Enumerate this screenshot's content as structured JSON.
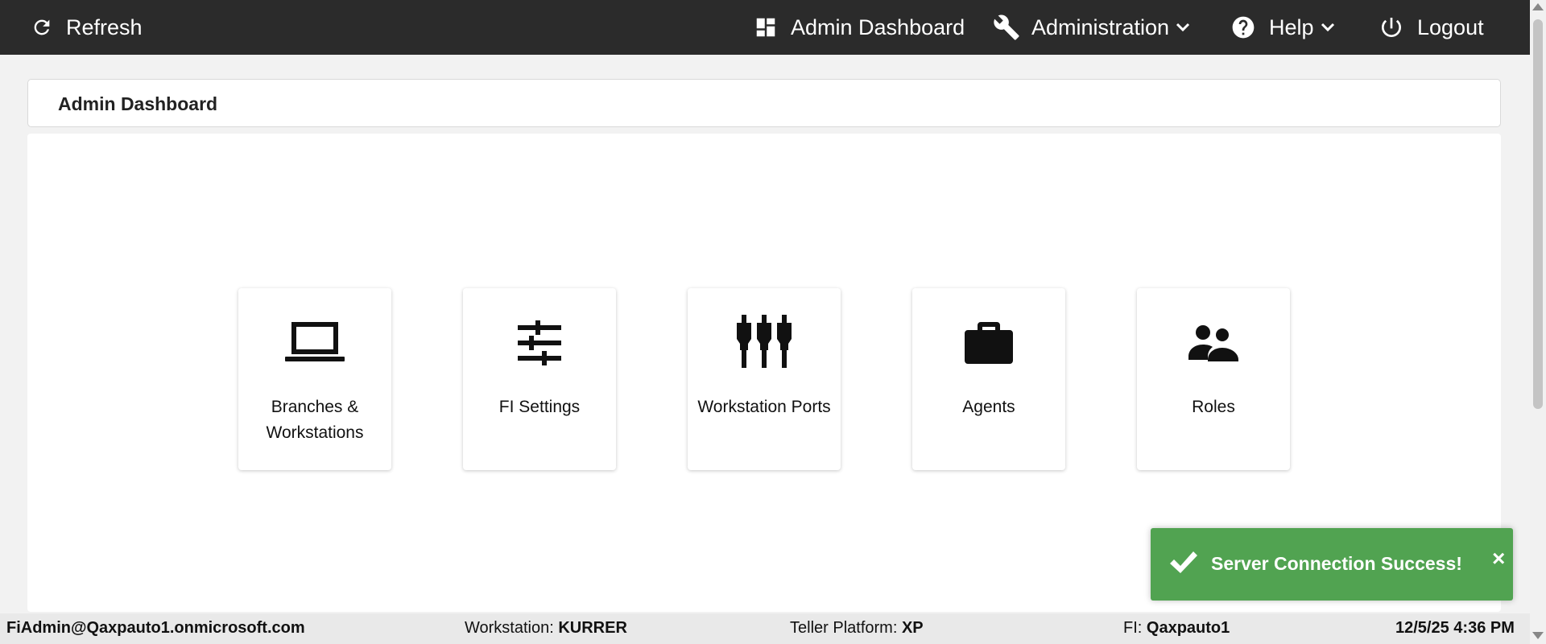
{
  "nav": {
    "refresh_label": "Refresh",
    "dashboard_label": "Admin Dashboard",
    "administration_label": "Administration",
    "help_label": "Help",
    "logout_label": "Logout"
  },
  "header": {
    "title": "Admin Dashboard"
  },
  "tiles": [
    {
      "label": "Branches & Workstations",
      "icon": "laptop-icon"
    },
    {
      "label": "FI Settings",
      "icon": "sliders-icon"
    },
    {
      "label": "Workstation Ports",
      "icon": "ports-icon"
    },
    {
      "label": "Agents",
      "icon": "briefcase-icon"
    },
    {
      "label": "Roles",
      "icon": "people-icon"
    }
  ],
  "toast": {
    "message": "Server Connection Success!",
    "close": "×",
    "color": "#51a351"
  },
  "status": {
    "user": "FiAdmin@Qaxpauto1.onmicrosoft.com",
    "workstation_label": "Workstation:",
    "workstation_value": "KURRER",
    "platform_label": "Teller Platform:",
    "platform_value": "XP",
    "fi_label": "FI:",
    "fi_value": "Qaxpauto1",
    "datetime": "12/5/25 4:36 PM"
  },
  "colors": {
    "topbar": "#2b2b2b",
    "background": "#f2f2f2",
    "success": "#51a351"
  }
}
